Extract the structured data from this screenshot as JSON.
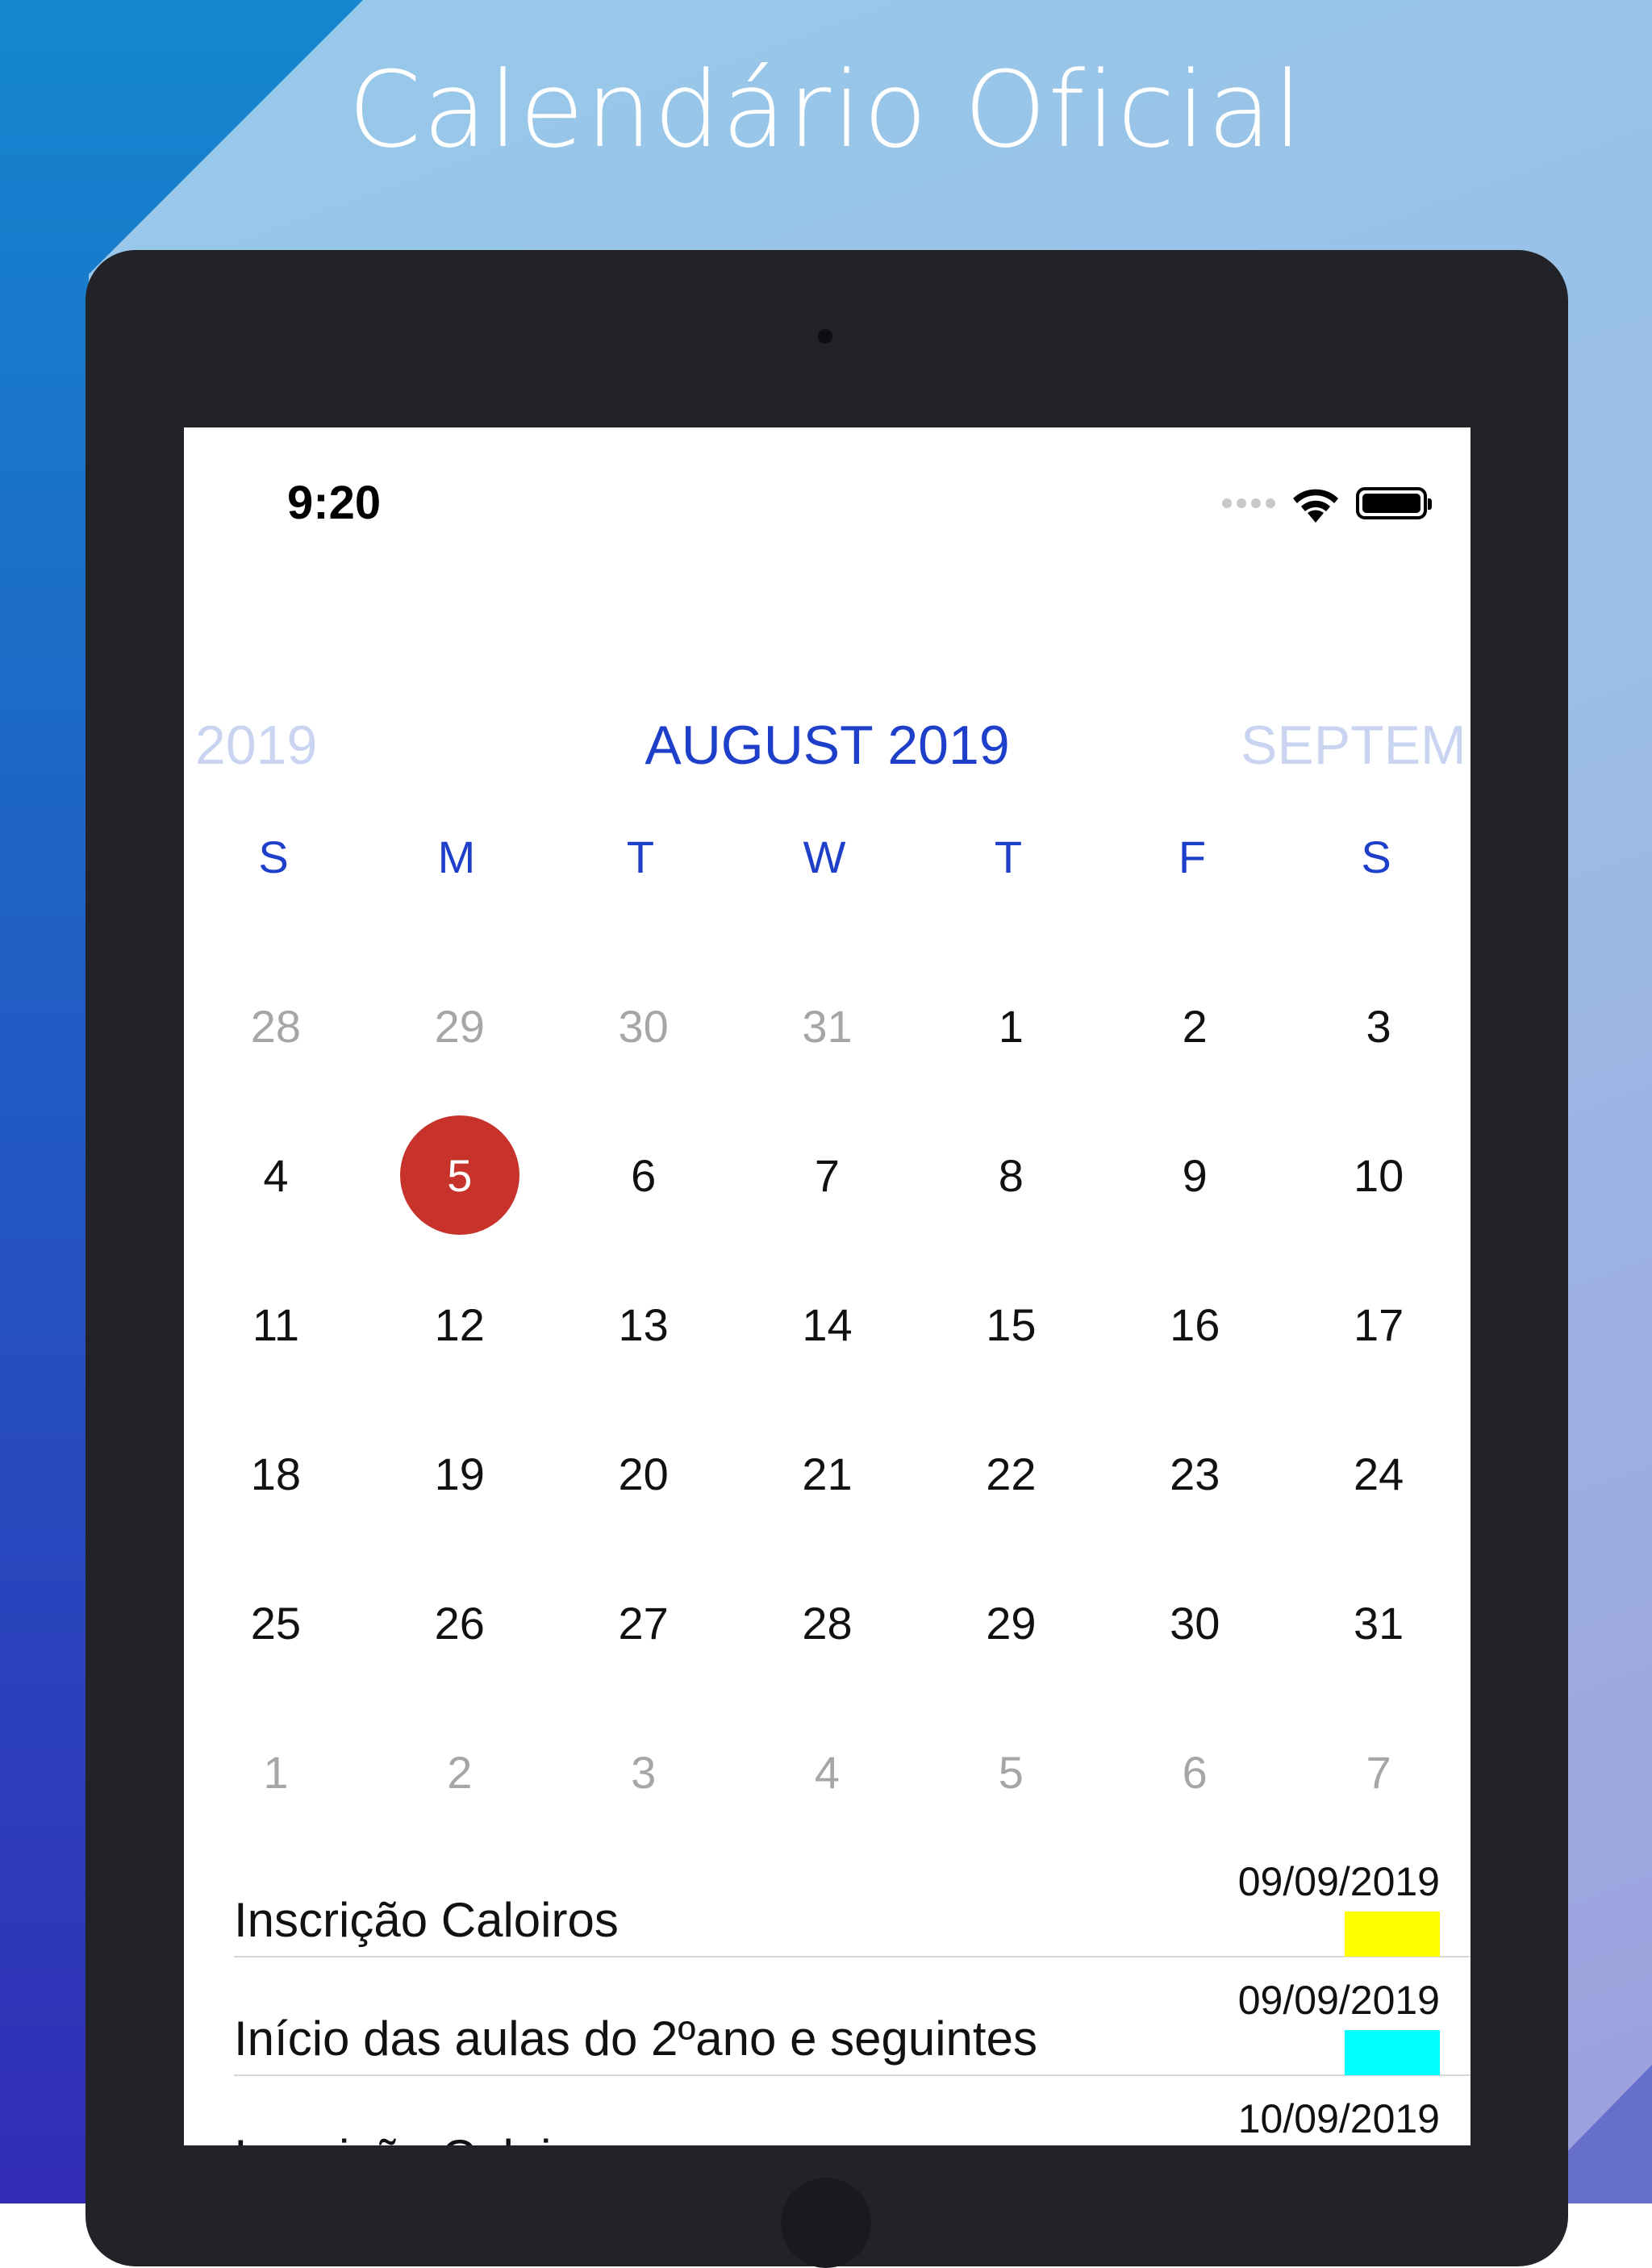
{
  "promo": {
    "headline": "Calendário Oficial"
  },
  "status_bar": {
    "time": "9:20"
  },
  "calendar": {
    "prev_month": "2019",
    "current_month": "AUGUST 2019",
    "next_month": "SEPTEMB",
    "weekdays": [
      "S",
      "M",
      "T",
      "W",
      "T",
      "F",
      "S"
    ],
    "weeks": [
      [
        {
          "d": "28",
          "m": true
        },
        {
          "d": "29",
          "m": true
        },
        {
          "d": "30",
          "m": true
        },
        {
          "d": "31",
          "m": true
        },
        {
          "d": "1"
        },
        {
          "d": "2"
        },
        {
          "d": "3"
        }
      ],
      [
        {
          "d": "4"
        },
        {
          "d": "5",
          "today": true
        },
        {
          "d": "6"
        },
        {
          "d": "7"
        },
        {
          "d": "8"
        },
        {
          "d": "9"
        },
        {
          "d": "10"
        }
      ],
      [
        {
          "d": "11"
        },
        {
          "d": "12"
        },
        {
          "d": "13"
        },
        {
          "d": "14"
        },
        {
          "d": "15"
        },
        {
          "d": "16"
        },
        {
          "d": "17"
        }
      ],
      [
        {
          "d": "18"
        },
        {
          "d": "19"
        },
        {
          "d": "20"
        },
        {
          "d": "21"
        },
        {
          "d": "22"
        },
        {
          "d": "23"
        },
        {
          "d": "24"
        }
      ],
      [
        {
          "d": "25"
        },
        {
          "d": "26"
        },
        {
          "d": "27"
        },
        {
          "d": "28"
        },
        {
          "d": "29"
        },
        {
          "d": "30"
        },
        {
          "d": "31"
        }
      ],
      [
        {
          "d": "1",
          "m": true
        },
        {
          "d": "2",
          "m": true
        },
        {
          "d": "3",
          "m": true
        },
        {
          "d": "4",
          "m": true
        },
        {
          "d": "5",
          "m": true
        },
        {
          "d": "6",
          "m": true
        },
        {
          "d": "7",
          "m": true
        }
      ]
    ],
    "today_color": "#c7322b",
    "accent_color": "#1d3fc9"
  },
  "events": [
    {
      "title": "Inscrição Caloiros",
      "date": "09/09/2019",
      "color": "#ffff00"
    },
    {
      "title": "Início das aulas do 2ºano e seguintes",
      "date": "09/09/2019",
      "color": "#00ffff"
    },
    {
      "title": "Inscrição Caloiros",
      "date": "10/09/2019",
      "color": "#ffff00"
    }
  ],
  "icons": {
    "wifi": "wifi-icon",
    "battery": "battery-icon",
    "signal": "signal-icon"
  }
}
